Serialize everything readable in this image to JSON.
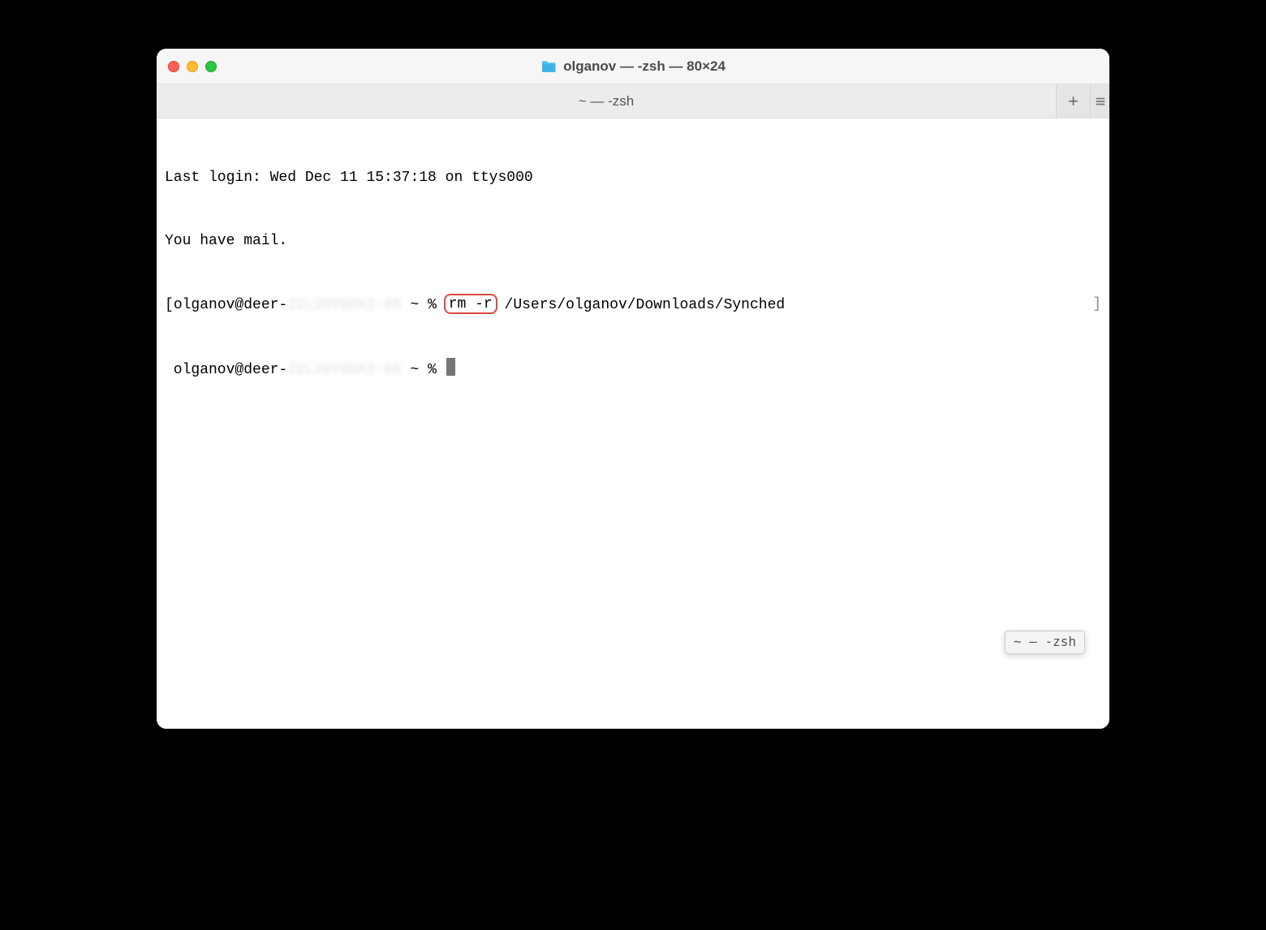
{
  "window": {
    "title": "olganov — -zsh — 80×24"
  },
  "tabbar": {
    "active_tab": "~ — -zsh",
    "new_tab_label": "+"
  },
  "terminal": {
    "line1": "Last login: Wed Dec 11 15:37:18 on ttys000",
    "line2": "You have mail.",
    "prompt1": {
      "open_bracket": "[",
      "user_host": "olganov@deer-",
      "blurred_hostname": "22L20YGDX2-05",
      "prompt_symbol": " ~ % ",
      "highlighted_cmd": "rm -r",
      "command_rest": " /Users/olganov/Downloads/Synched",
      "close_bracket": "]"
    },
    "prompt2": {
      "user_host": " olganov@deer-",
      "blurred_hostname": "22L20YGDX2-05",
      "prompt_symbol": " ~ % "
    }
  },
  "tooltip": {
    "text": "~ — -zsh"
  }
}
